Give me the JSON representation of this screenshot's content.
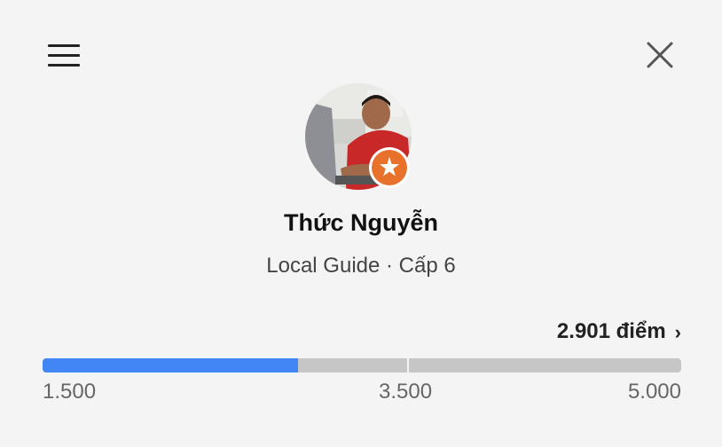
{
  "header": {
    "menu_icon": "hamburger-menu-icon",
    "close_icon": "close-icon"
  },
  "profile": {
    "name": "Thức Nguyễn",
    "subtitle": "Local Guide · Cấp 6",
    "badge_icon": "local-guide-star-icon",
    "badge_color": "#e8712c"
  },
  "progress": {
    "points_label": "2.901 điểm",
    "points_chevron": "›",
    "fill_fraction": 0.4,
    "current_level_threshold": "1.500",
    "mid_marker": "3.500",
    "next_level_threshold": "5.000",
    "fill_color": "#4285f4",
    "track_color": "#c6c6c6"
  }
}
